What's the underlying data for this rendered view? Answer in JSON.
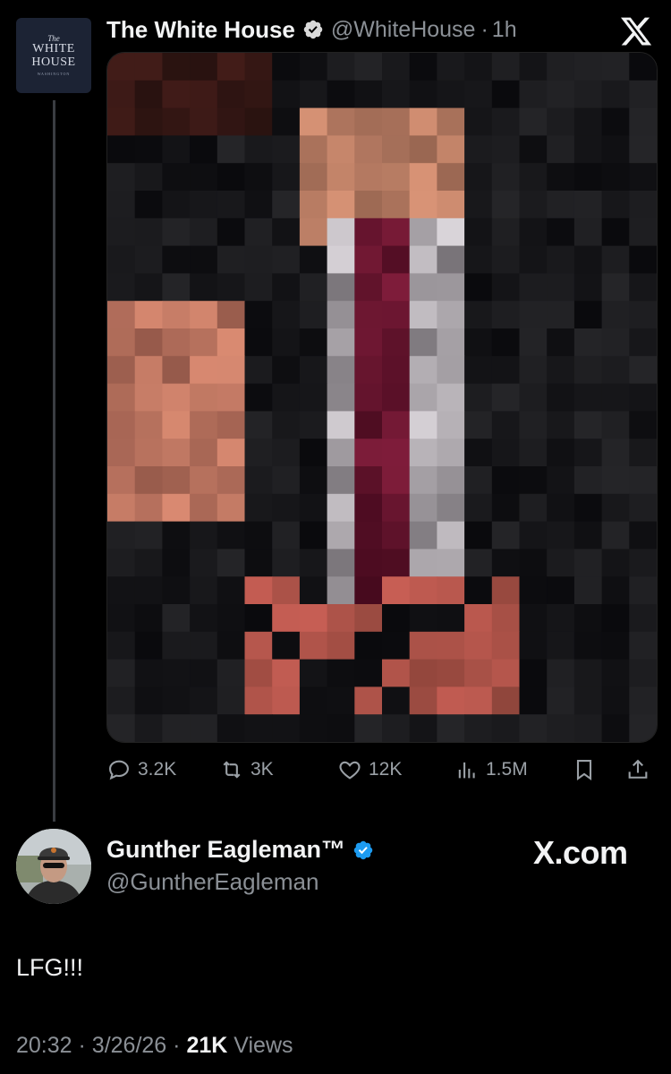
{
  "quoted_post": {
    "author_name": "The White House",
    "handle": "@WhiteHouse",
    "separator": "·",
    "time_ago": "1h",
    "verified": true,
    "avatar_text": [
      "The",
      "WHITE",
      "HOUSE",
      "WASHINGTON"
    ],
    "media_description_icon": "pixelated-photo",
    "actions": {
      "replies": "3.2K",
      "reposts": "3K",
      "likes": "12K",
      "views": "1.5M"
    }
  },
  "main_post": {
    "author_name": "Gunther Eagleman™",
    "handle": "@GuntherEagleman",
    "verified": true,
    "watermark": "X.com",
    "text": "LFG!!!",
    "time": "20:32",
    "date": "3/26/26",
    "views_count": "21K",
    "views_label": "Views",
    "separator": "·"
  },
  "colors": {
    "background": "#000000",
    "verified_badge": "#1d9bf0",
    "muted_text": "#8b9096",
    "primary_text": "#f2f3f4",
    "thread_line": "#3a3d42"
  }
}
